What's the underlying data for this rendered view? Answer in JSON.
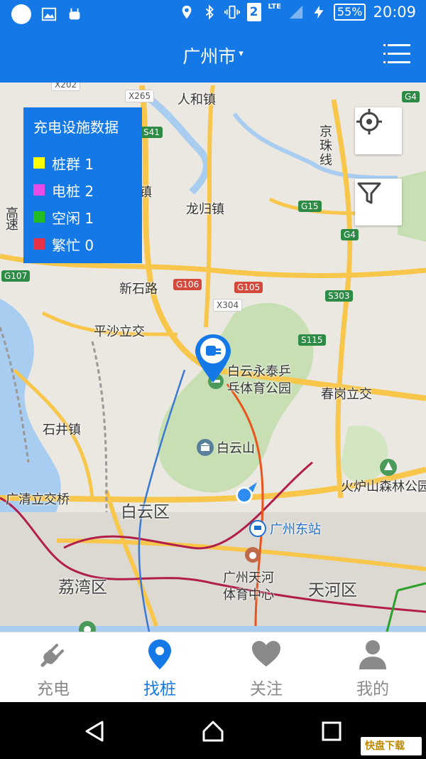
{
  "status_bar": {
    "signal_badge": "2",
    "network": "LTE",
    "battery": "55%",
    "time": "20:09"
  },
  "header": {
    "city": "广州市",
    "caret": "▾"
  },
  "legend": {
    "title": "充电设施数据",
    "items": [
      {
        "label": "桩群 1",
        "color": "#ffff00"
      },
      {
        "label": "电桩 2",
        "color": "#e84ce8"
      },
      {
        "label": "空闲 1",
        "color": "#22bb22"
      },
      {
        "label": "繁忙 0",
        "color": "#e8324a"
      }
    ]
  },
  "map": {
    "labels": {
      "renhe": "人和镇",
      "longgui": "龙归镇",
      "jingzhu": "京珠线",
      "xinshilu": "新石路",
      "pingsha": "平沙立交",
      "baiyun_yongtai": "白云永泰乒",
      "baiyun_yongtai2": "乓体育公园",
      "chungang": "春岗立交",
      "shijing": "石井镇",
      "baiyunshan": "白云山",
      "huolushan": "火炉山森林公园",
      "guangqing": "广清立交桥",
      "baiyunqu": "白云区",
      "guangzhoudong": "广州东站",
      "liwan": "荔湾区",
      "tianhe_sports": "广州天河",
      "tianhe_sports2": "体育中心",
      "tianhequ": "天河区",
      "zhen": "镇",
      "gao": "高",
      "su": "速"
    },
    "shields": {
      "x202": "X202",
      "x265": "X265",
      "s41": "S41",
      "g4a": "G4",
      "g4b": "G4",
      "g15": "G15",
      "g107": "G107",
      "g106": "G106",
      "g105": "G105",
      "x304": "X304",
      "s303": "S303",
      "s115": "S115"
    }
  },
  "bottom_nav": [
    {
      "label": "充电",
      "icon": "plug-icon"
    },
    {
      "label": "找桩",
      "icon": "map-pin-icon"
    },
    {
      "label": "关注",
      "icon": "heart-icon"
    },
    {
      "label": "我的",
      "icon": "user-icon"
    }
  ],
  "watermark": "快盘下载"
}
